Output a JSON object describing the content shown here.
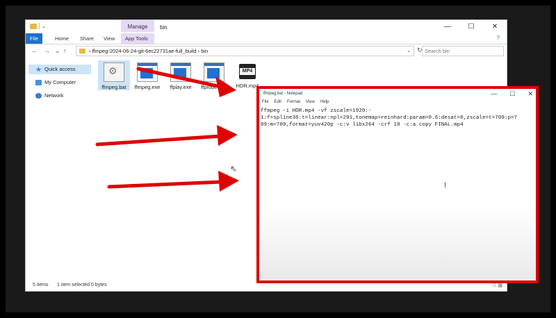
{
  "explorer": {
    "quick_access_glyph": "⌄",
    "manage_tab": "Manage",
    "window_title": "bin",
    "window_controls": {
      "minimize": "—",
      "maximize": "☐",
      "close": "✕"
    },
    "ribbon_tabs": {
      "file": "File",
      "home": "Home",
      "share": "Share",
      "view": "View",
      "app_tools": "App Tools"
    },
    "help_glyph": "?",
    "nav": {
      "back": "←",
      "forward": "→",
      "recent": "⌄",
      "up": "↑"
    },
    "address_path": "›  ffmpeg-2024-06-24-git-6ec22731ae-full_build  ›  bin",
    "address_dropdown": "⌄",
    "refresh_glyph": "↻",
    "search_placeholder": "Search bin",
    "sidebar": [
      {
        "label": "Quick access",
        "icon": "star-icon"
      },
      {
        "label": "My Computer",
        "icon": "computer-icon"
      },
      {
        "label": "Network",
        "icon": "network-icon"
      }
    ],
    "files": [
      {
        "label": "ffmpeg.bat",
        "icon": "batch-file-icon",
        "selected": true
      },
      {
        "label": "ffmpeg.exe",
        "icon": "exe-file-icon"
      },
      {
        "label": "ffplay.exe",
        "icon": "exe-file-icon"
      },
      {
        "label": "ffprobe.exe",
        "icon": "exe-file-icon"
      },
      {
        "label": "HDR.mp4",
        "icon": "mp4-file-icon",
        "badge": "MP4"
      }
    ],
    "status": {
      "count": "5 items",
      "selected": "1 item selected  0 bytes",
      "view_icons": "☷ ▦"
    }
  },
  "notepad": {
    "title": "ffmpeg.bat - Notepad",
    "window_controls": {
      "minimize": "—",
      "maximize": "☐",
      "close": "✕"
    },
    "menu": [
      "File",
      "Edit",
      "Format",
      "View",
      "Help"
    ],
    "content": "ffmpeg -i HDR.mp4 -vf zscale=1920:-\n1:f=spline36:t=linear:npl=291,tonemap=reinhard:param=0.6:desat=0,zscale=t=709:p=7\n09:m=709,format=yuv420p -c:v libx264 -crf 18 -c:a copy FINAL.mp4",
    "cursor_glyph": "I"
  },
  "overlay": {
    "highlight_color": "#e00000",
    "arrow_color": "#e00000",
    "pointer_glyph": "⇖"
  }
}
